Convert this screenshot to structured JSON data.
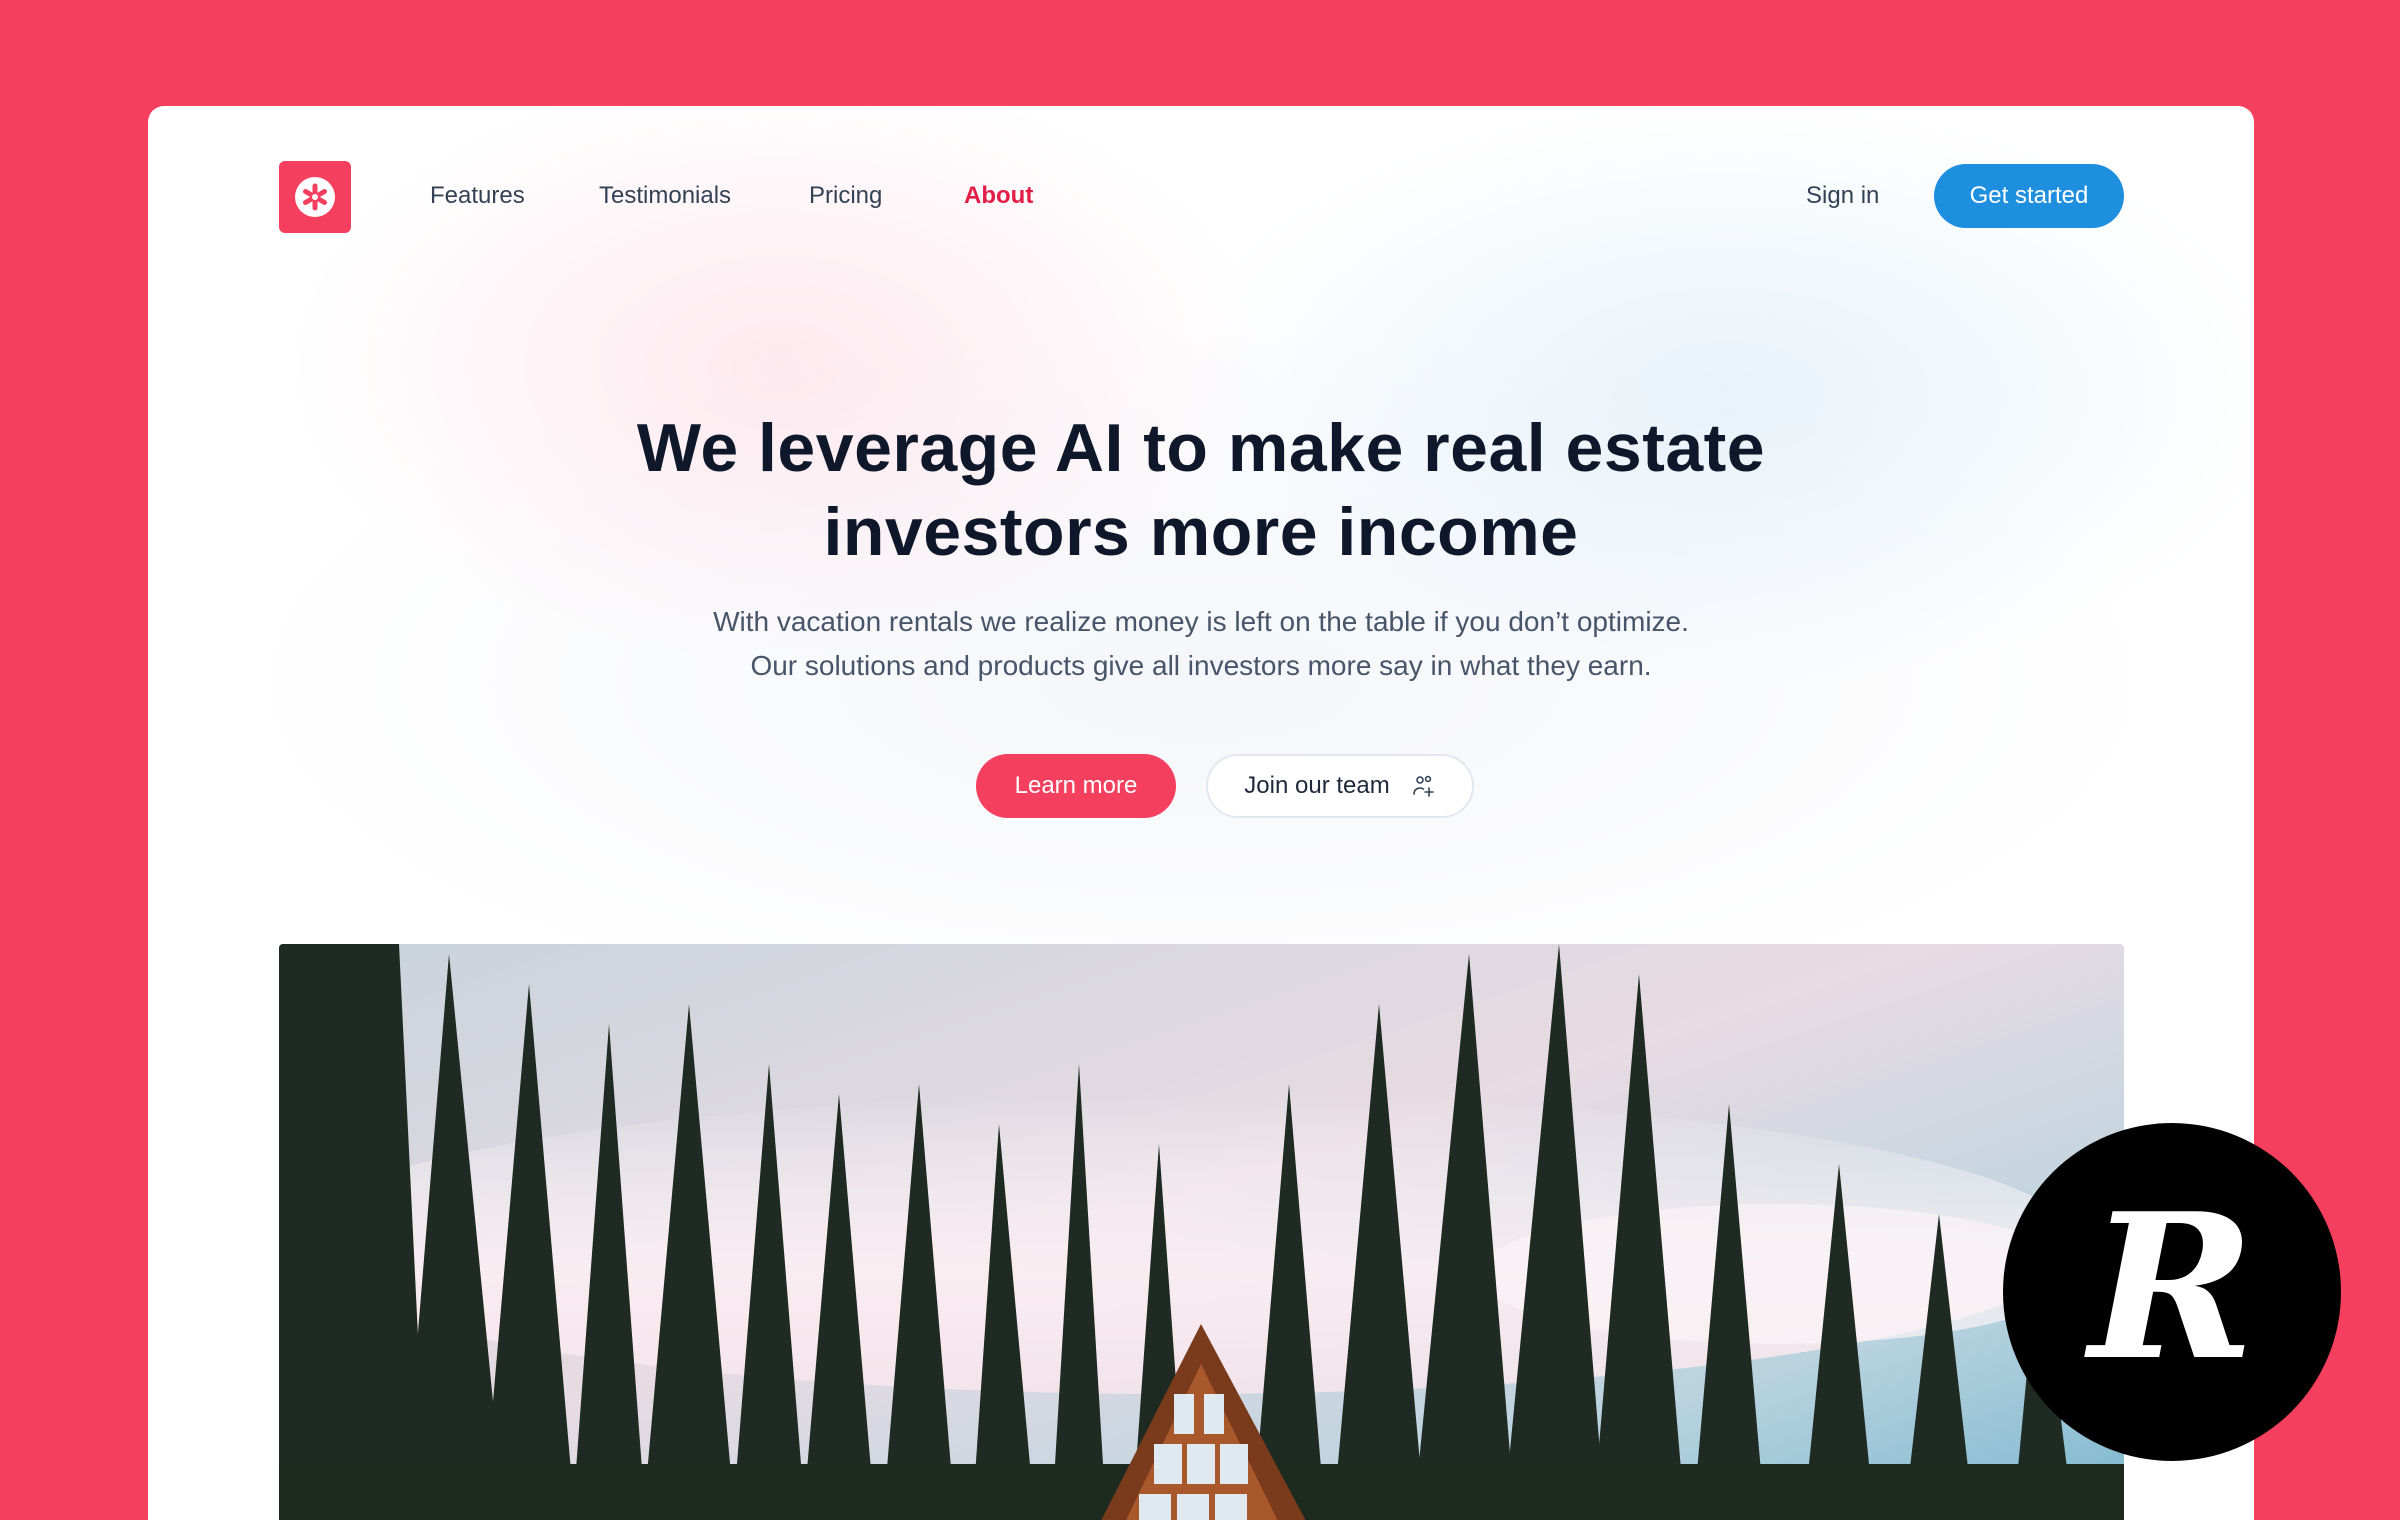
{
  "brand": {
    "logo_icon": "asterisk-logo-icon",
    "accent_color": "#f43f5e",
    "cta_color": "#1e8fdf"
  },
  "nav": {
    "links": [
      {
        "label": "Features",
        "active": false
      },
      {
        "label": "Testimonials",
        "active": false
      },
      {
        "label": "Pricing",
        "active": false
      },
      {
        "label": "About",
        "active": true
      }
    ],
    "sign_in": "Sign in",
    "get_started": "Get started"
  },
  "hero": {
    "title_line1": "We leverage AI to make real estate",
    "title_line2": "investors more income",
    "subtitle_line1": "With vacation rentals we realize money is left on the table if you don’t optimize.",
    "subtitle_line2": "Our solutions and products give all investors more say in what they earn.",
    "learn_more": "Learn more",
    "join_team": "Join our team",
    "join_icon": "user-plus-icon"
  },
  "photo": {
    "subject": "a-frame-cabin-in-forest"
  },
  "badge": {
    "letter": "R"
  }
}
